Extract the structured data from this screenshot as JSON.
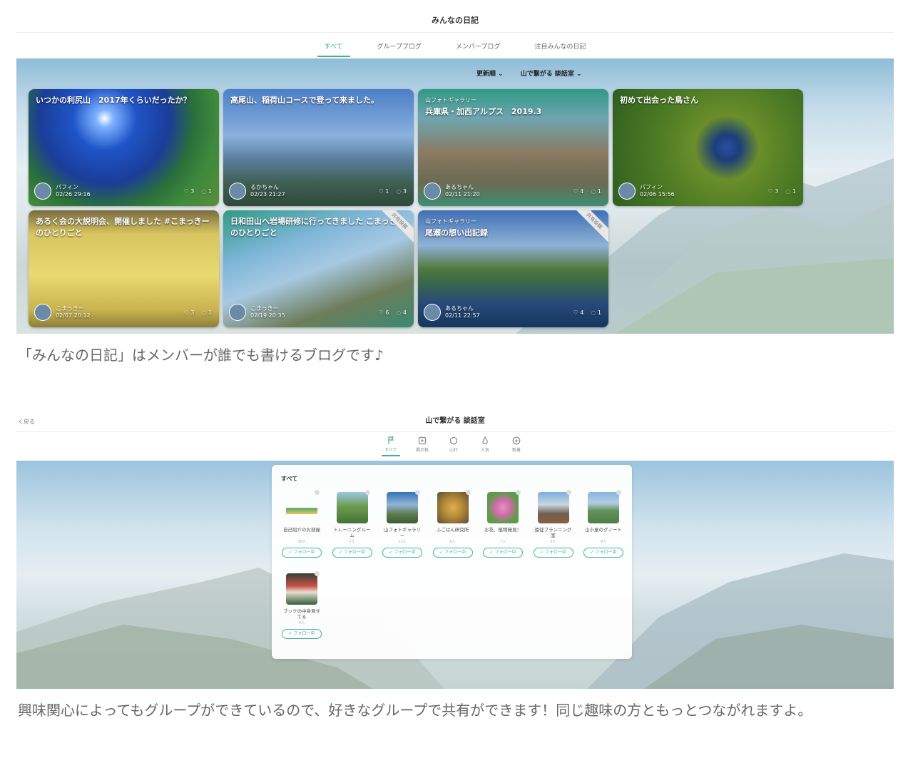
{
  "shot1": {
    "title": "みんなの日記",
    "tabs": [
      "すべて",
      "グループブログ",
      "メンバーブログ",
      "注目みんなの日記"
    ],
    "sort": "更新順",
    "group_filter": "山で繋がる 談話室",
    "cards": [
      {
        "title": "いつかの利尻山　2017年くらいだったか？",
        "gallery": "",
        "user": "パフィン",
        "date": "02/26 29:16",
        "likes": "3",
        "comments": "1",
        "ribbon": ""
      },
      {
        "title": "高尾山、稲荷山コースで登って来ました。",
        "gallery": "",
        "user": "るかちゃん",
        "date": "02/23 21:27",
        "likes": "1",
        "comments": "3",
        "ribbon": ""
      },
      {
        "title": "兵庫県・加西アルプス　2019.3",
        "gallery": "山フォトギャラリー",
        "user": "あるちゃん",
        "date": "02/11 21:20",
        "likes": "4",
        "comments": "1",
        "ribbon": ""
      },
      {
        "title": "初めて出会った鳥さん",
        "gallery": "",
        "user": "パフィン",
        "date": "02/06 15:56",
        "likes": "3",
        "comments": "1",
        "ribbon": ""
      },
      {
        "title": "あるく会の大説明会、開催しました #こまっきーのひとりごと",
        "gallery": "",
        "user": "こまっきー",
        "date": "02/07 20:12",
        "likes": "3",
        "comments": "1",
        "ribbon": ""
      },
      {
        "title": "日和田山へ岩場研修に行ってきました こまっきーのひとりごと",
        "gallery": "",
        "user": "こまっきー",
        "date": "02/19 20:35",
        "likes": "6",
        "comments": "4",
        "ribbon": "共有投稿"
      },
      {
        "title": "尾瀬の想い出記録",
        "gallery": "山フォトギャラリー",
        "user": "あるちゃん",
        "date": "02/11 22:57",
        "likes": "4",
        "comments": "1",
        "ribbon": "共有投稿"
      }
    ]
  },
  "caption1": "「みんなの日記」はメンバーが誰でも書けるブログです♪",
  "shot2": {
    "back": "く戻る",
    "title": "山で繋がる 談話室",
    "icon_tabs": [
      "すべて",
      "掲示板",
      "山行",
      "人気",
      "新着"
    ],
    "panel_heading": "すべて",
    "groups": [
      {
        "name": "自己紹介のお部屋",
        "members": "36人",
        "follow": "フォロー中"
      },
      {
        "name": "トレーニングルーム",
        "members": "7人",
        "follow": "フォロー中"
      },
      {
        "name": "山フォトギャラリー",
        "members": "13人",
        "follow": "フォロー中"
      },
      {
        "name": "ふごはん研究所",
        "members": "6人",
        "follow": "フォロー中"
      },
      {
        "name": "お花、植物発見！",
        "members": "7人",
        "follow": "フォロー中"
      },
      {
        "name": "遠征プランニング室",
        "members": "5人",
        "follow": "フォロー中"
      },
      {
        "name": "山小屋のグノート",
        "members": "4人",
        "follow": "フォロー中"
      },
      {
        "name": "ブックの中身見せてる",
        "members": "4人",
        "follow": "フォロー中"
      }
    ]
  },
  "caption2": "興味関心によってもグループができているので、好きなグループで共有ができます！同じ趣味の方ともっとつながれますよ。",
  "colors": {
    "accent": "#3cb393"
  }
}
